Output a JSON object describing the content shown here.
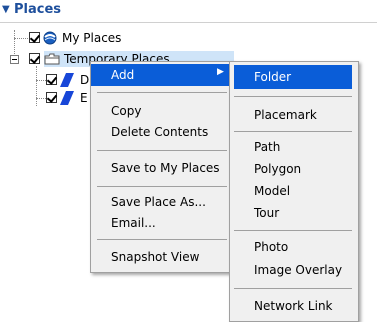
{
  "panel": {
    "title": "Places"
  },
  "tree": {
    "my_places": "My Places",
    "temporary_places": "Temporary Places",
    "child1_initial": "D",
    "child2_initial": "E"
  },
  "context_menu": {
    "items": [
      "Add",
      "Copy",
      "Delete Contents",
      "Save to My Places",
      "Save Place As...",
      "Email...",
      "Snapshot View"
    ]
  },
  "add_submenu": {
    "items": [
      "Folder",
      "Placemark",
      "Path",
      "Polygon",
      "Model",
      "Tour",
      "Photo",
      "Image Overlay",
      "Network Link"
    ]
  },
  "colors": {
    "accent": "#1e4f9c",
    "highlight": "#0a5dd8",
    "selection": "#cfe4f8",
    "menu_bg": "#f0f0f0"
  }
}
